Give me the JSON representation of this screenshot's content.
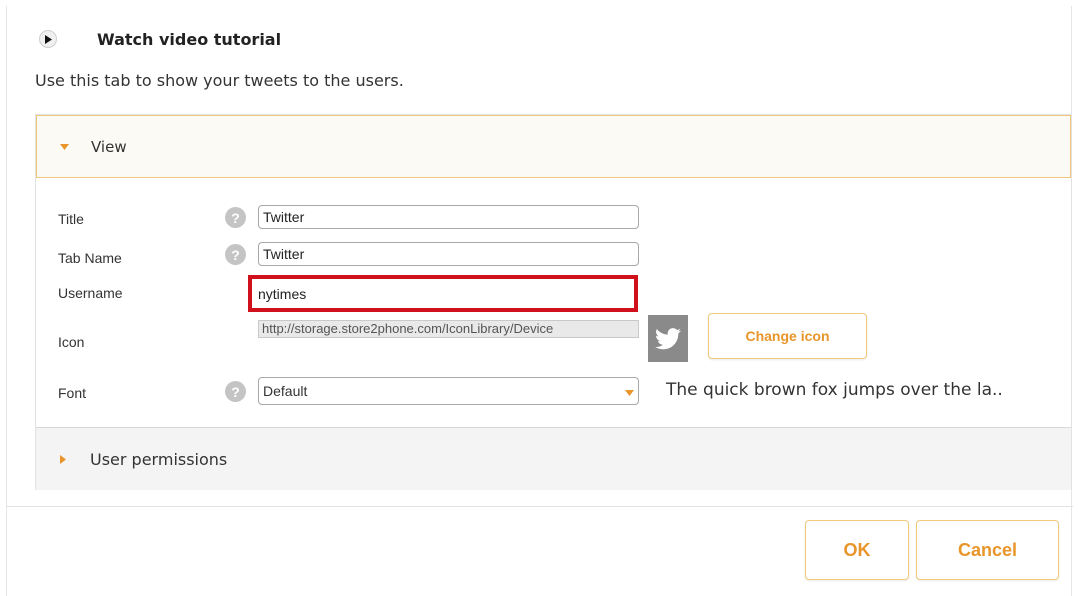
{
  "header": {
    "tutorial_label": "Watch video tutorial",
    "intro_text": "Use this tab to show your tweets to the users."
  },
  "view_section": {
    "label": "View",
    "fields": {
      "title": {
        "label": "Title",
        "value": "Twitter"
      },
      "tab_name": {
        "label": "Tab Name",
        "value": "Twitter"
      },
      "username": {
        "label": "Username",
        "value": "nytimes"
      },
      "icon": {
        "label": "Icon",
        "url": "http://storage.store2phone.com/IconLibrary/Device",
        "change_label": "Change icon"
      },
      "font": {
        "label": "Font",
        "selected": "Default",
        "preview": "The quick brown fox jumps over the la.."
      }
    },
    "help_glyph": "?"
  },
  "permissions_section": {
    "label": "User permissions"
  },
  "footer": {
    "ok_label": "OK",
    "cancel_label": "Cancel"
  },
  "colors": {
    "accent": "#e8952a",
    "highlight_border": "#d0111b",
    "section_border": "#f0c87a",
    "twitter_tile": "#8a8a8a"
  },
  "icons": {
    "play": "play-icon",
    "help": "help-icon",
    "caret_open": "caret-down-icon",
    "caret_closed": "caret-right-icon",
    "twitter": "twitter-bird-icon",
    "dropdown": "chevron-down-icon"
  }
}
